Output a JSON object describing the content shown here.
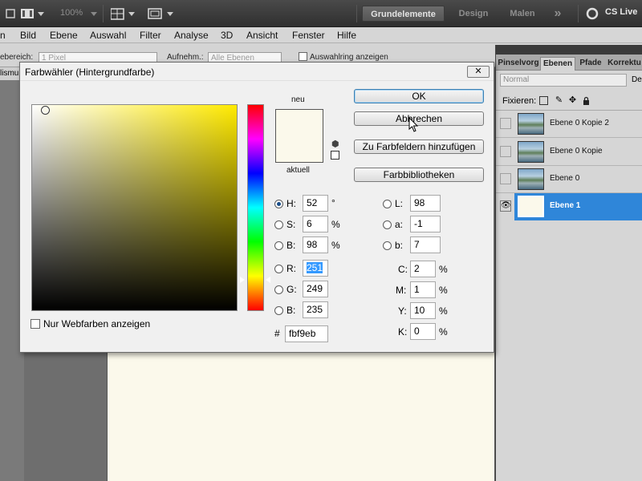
{
  "topbar": {
    "zoom": "100%",
    "workspaces": [
      "Grundelemente",
      "Design",
      "Malen"
    ],
    "more": "»",
    "cslive": "CS Live"
  },
  "menu": [
    "n",
    "Bild",
    "Ebene",
    "Auswahl",
    "Filter",
    "Analyse",
    "3D",
    "Ansicht",
    "Fenster",
    "Hilfe"
  ],
  "options": {
    "range_label": "ebereich:",
    "range_value": "1 Pixel",
    "sample_label": "Aufnehm.:",
    "sample_value": "Alle Ebenen",
    "ring_label": "Auswahlring anzeigen"
  },
  "doc_tab": "lismu",
  "layers_panel": {
    "tabs": [
      "Pinselvorg",
      "Ebenen",
      "Pfade",
      "Korrektu"
    ],
    "active_tab": "Ebenen",
    "blend_mode": "Normal",
    "opacity_label": "Dec",
    "lock_label": "Fixieren:",
    "layers": [
      {
        "name": "Ebene 0 Kopie 2",
        "visible": false,
        "selected": false
      },
      {
        "name": "Ebene 0 Kopie",
        "visible": false,
        "selected": false
      },
      {
        "name": "Ebene 0",
        "visible": false,
        "selected": false
      },
      {
        "name": "Ebene 1",
        "visible": true,
        "selected": true
      }
    ]
  },
  "dialog": {
    "title": "Farbwähler (Hintergrundfarbe)",
    "close": "✕",
    "new_label": "neu",
    "current_label": "aktuell",
    "swatch_color": "#fbf9eb",
    "buttons": {
      "ok": "OK",
      "cancel": "Abbrechen",
      "add_swatch": "Zu Farbfeldern hinzufügen",
      "libraries": "Farbbibliotheken"
    },
    "hsb": {
      "h_label": "H:",
      "h": "52",
      "h_unit": "°",
      "s_label": "S:",
      "s": "6",
      "s_unit": "%",
      "b_label": "B:",
      "b": "98",
      "b_unit": "%"
    },
    "rgb": {
      "r_label": "R:",
      "r": "251",
      "g_label": "G:",
      "g": "249",
      "b_label": "B:",
      "b": "235"
    },
    "lab": {
      "l_label": "L:",
      "l": "98",
      "a_label": "a:",
      "a": "-1",
      "b_label": "b:",
      "b": "7"
    },
    "cmyk": {
      "c_label": "C:",
      "c": "2",
      "m_label": "M:",
      "m": "1",
      "y_label": "Y:",
      "y": "10",
      "k_label": "K:",
      "k": "0",
      "unit": "%"
    },
    "hex_label": "#",
    "hex": "fbf9eb",
    "web_only_label": "Nur Webfarben anzeigen"
  }
}
